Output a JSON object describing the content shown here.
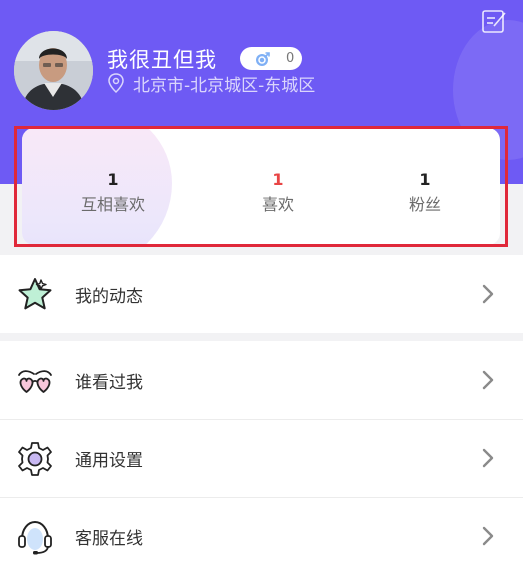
{
  "profile": {
    "username": "我很丑但我",
    "gender_count": "0",
    "location": "北京市-北京城区-东城区"
  },
  "stats": [
    {
      "value": "1",
      "label": "互相喜欢",
      "value_color": "#222222"
    },
    {
      "value": "1",
      "label": "喜欢",
      "value_color": "#e84545"
    },
    {
      "value": "1",
      "label": "粉丝",
      "value_color": "#222222"
    }
  ],
  "menu": {
    "dynamics": "我的动态",
    "visitors": "谁看过我",
    "settings": "通用设置",
    "support": "客服在线"
  },
  "colors": {
    "header": "#6e5af4",
    "highlight": "#e0283a"
  }
}
